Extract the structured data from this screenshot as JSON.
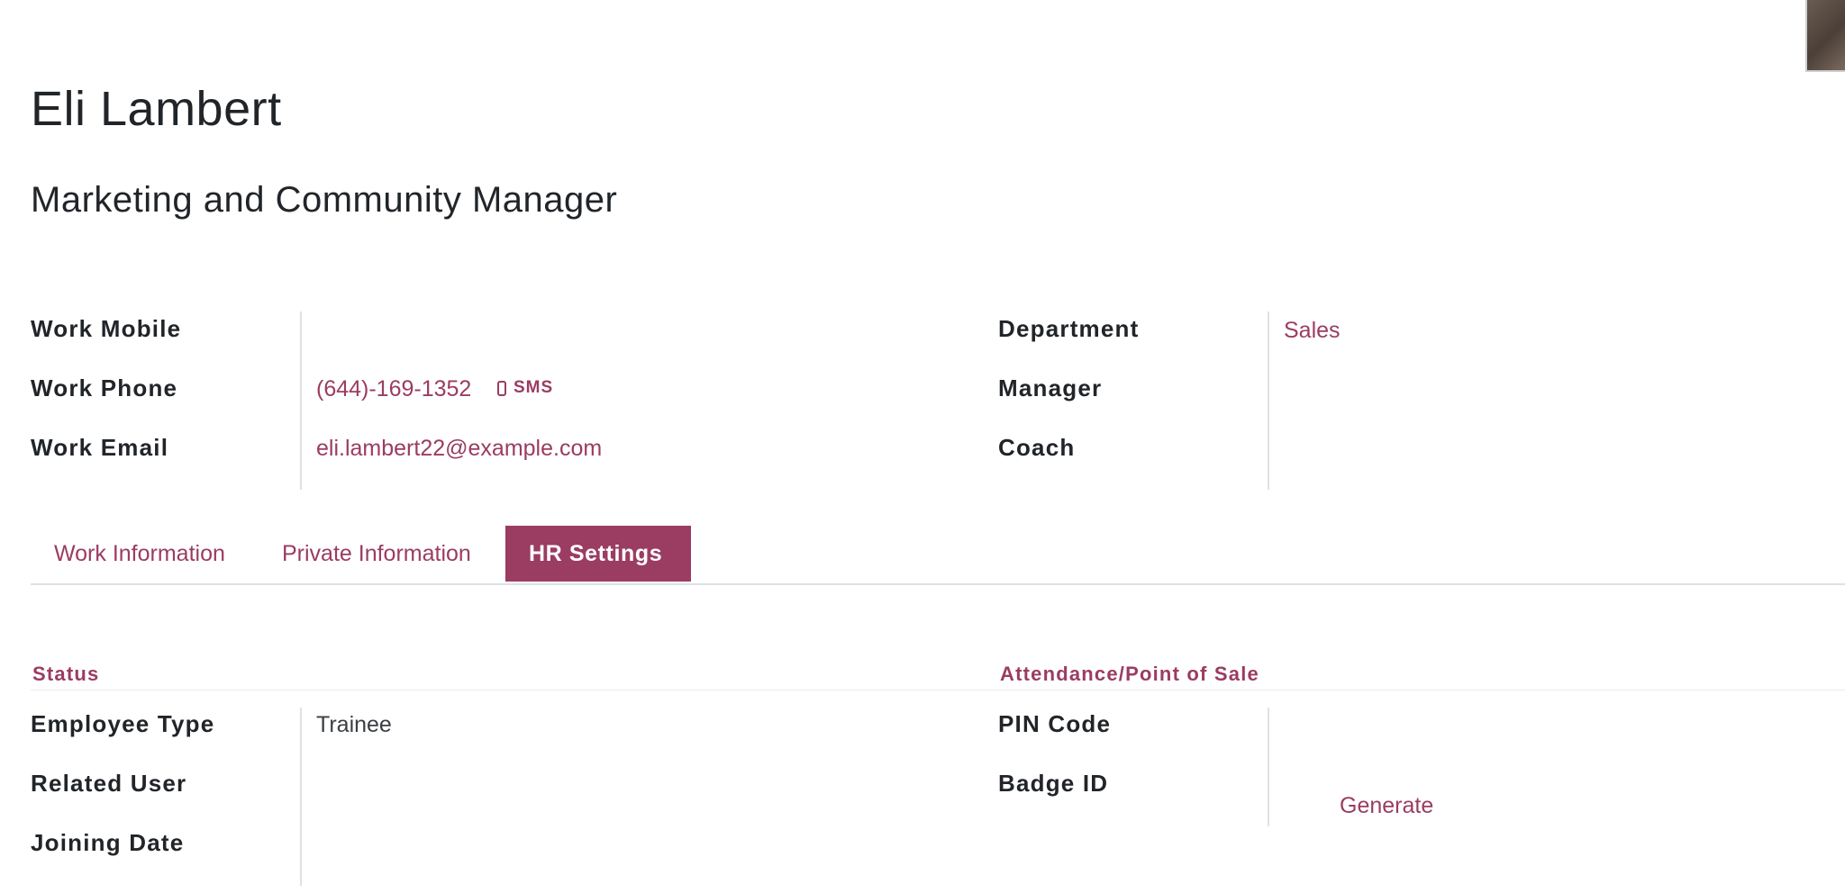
{
  "employee": {
    "name": "Eli Lambert",
    "job_title": "Marketing and Community Manager"
  },
  "contact": {
    "work_mobile_label": "Work Mobile",
    "work_mobile_value": "",
    "work_phone_label": "Work Phone",
    "work_phone_value": "(644)-169-1352",
    "sms_label": "SMS",
    "work_email_label": "Work Email",
    "work_email_value": "eli.lambert22@example.com"
  },
  "org": {
    "department_label": "Department",
    "department_value": "Sales",
    "manager_label": "Manager",
    "manager_value": "",
    "coach_label": "Coach",
    "coach_value": ""
  },
  "tabs": [
    {
      "label": "Work Information",
      "active": false
    },
    {
      "label": "Private Information",
      "active": false
    },
    {
      "label": "HR Settings",
      "active": true
    }
  ],
  "status_section": {
    "title": "Status",
    "employee_type_label": "Employee Type",
    "employee_type_value": "Trainee",
    "related_user_label": "Related User",
    "related_user_value": "",
    "joining_date_label": "Joining Date",
    "joining_date_value": ""
  },
  "attendance_section": {
    "title": "Attendance/Point of Sale",
    "pin_code_label": "PIN Code",
    "pin_code_value": "",
    "badge_id_label": "Badge ID",
    "badge_id_value": "",
    "generate_label": "Generate"
  },
  "colors": {
    "accent": "#9b3c62",
    "text": "#212529",
    "divider": "#dee2e6"
  },
  "icons": [
    "mobile-phone-icon"
  ]
}
